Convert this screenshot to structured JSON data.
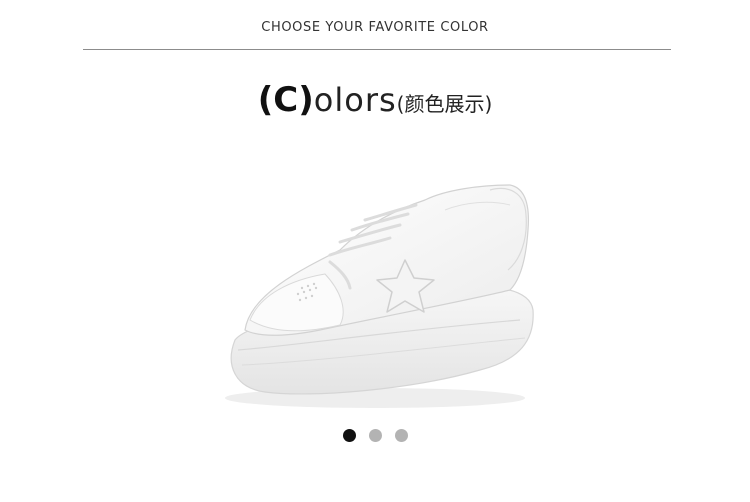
{
  "header": {
    "caption": "CHOOSE YOUR FAVORITE COLOR"
  },
  "title": {
    "bracketed": "(C)",
    "rest": "olors",
    "chinese": "(颜色展示)"
  },
  "product": {
    "image_name": "white-platform-sneaker-star"
  },
  "carousel": {
    "dots": [
      {
        "active": true,
        "color": "#111111"
      },
      {
        "active": false,
        "color": "#b3b3b3"
      },
      {
        "active": false,
        "color": "#b3b3b3"
      }
    ]
  }
}
